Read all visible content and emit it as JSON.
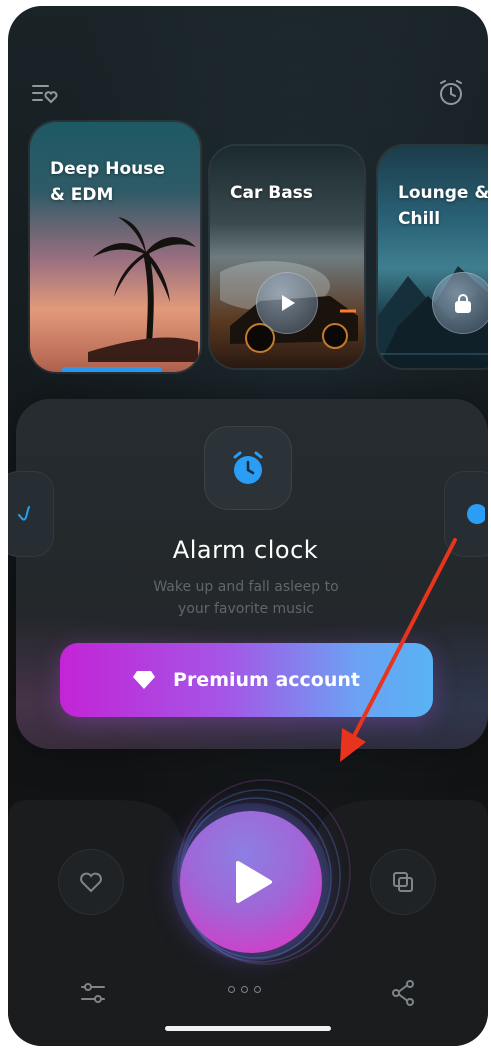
{
  "cards": [
    {
      "title": "Deep House\n& EDM",
      "state": "playing"
    },
    {
      "title": "Car Bass",
      "action_icon": "play-icon"
    },
    {
      "title": "Lounge &\nChill",
      "action_icon": "lock-icon"
    }
  ],
  "alarm": {
    "title": "Alarm clock",
    "subtitle": "Wake up and fall asleep to your favorite music"
  },
  "premium": {
    "label": "Premium account"
  },
  "colors": {
    "accent": "#2a9df4",
    "premium_start": "#c324d6",
    "premium_end": "#58b3f4",
    "annotation_arrow": "#e8341c"
  }
}
